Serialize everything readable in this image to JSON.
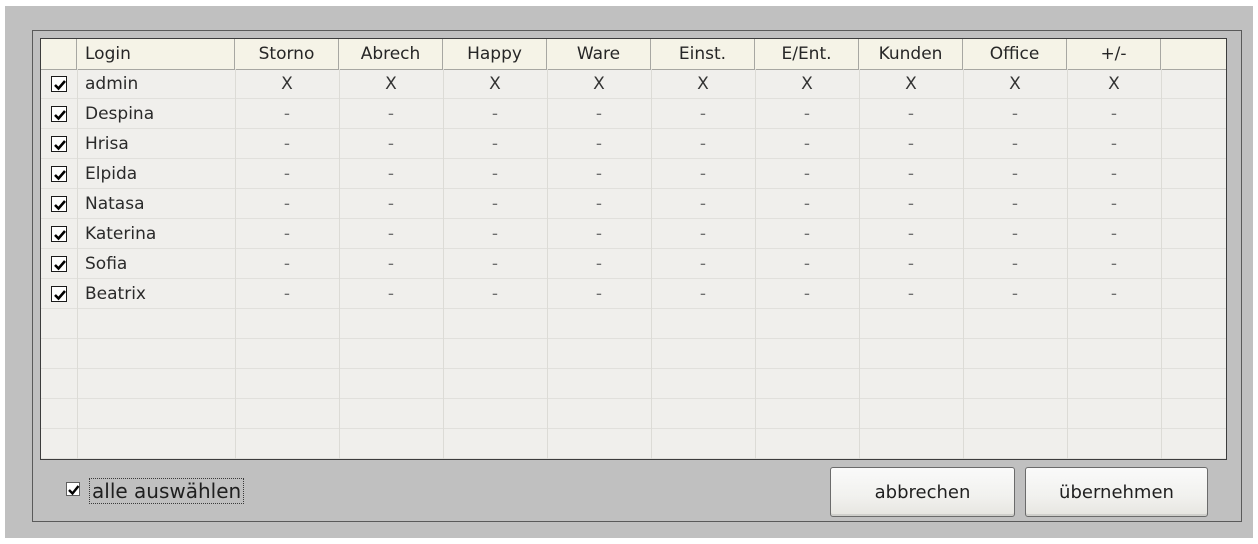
{
  "columns": {
    "login": "Login",
    "storno": "Storno",
    "abrech": "Abrech",
    "happy": "Happy",
    "ware": "Ware",
    "einst": "Einst.",
    "eent": "E/Ent.",
    "kunden": "Kunden",
    "office": "Office",
    "plusminus": "+/-"
  },
  "rows": [
    {
      "checked": true,
      "login": "admin",
      "storno": "X",
      "abrech": "X",
      "happy": "X",
      "ware": "X",
      "einst": "X",
      "eent": "X",
      "kunden": "X",
      "office": "X",
      "plusminus": "X"
    },
    {
      "checked": true,
      "login": "Despina",
      "storno": "-",
      "abrech": "-",
      "happy": "-",
      "ware": "-",
      "einst": "-",
      "eent": "-",
      "kunden": "-",
      "office": "-",
      "plusminus": "-"
    },
    {
      "checked": true,
      "login": "Hrisa",
      "storno": "-",
      "abrech": "-",
      "happy": "-",
      "ware": "-",
      "einst": "-",
      "eent": "-",
      "kunden": "-",
      "office": "-",
      "plusminus": "-"
    },
    {
      "checked": true,
      "login": "Elpida",
      "storno": "-",
      "abrech": "-",
      "happy": "-",
      "ware": "-",
      "einst": "-",
      "eent": "-",
      "kunden": "-",
      "office": "-",
      "plusminus": "-"
    },
    {
      "checked": true,
      "login": "Natasa",
      "storno": "-",
      "abrech": "-",
      "happy": "-",
      "ware": "-",
      "einst": "-",
      "eent": "-",
      "kunden": "-",
      "office": "-",
      "plusminus": "-"
    },
    {
      "checked": true,
      "login": "Katerina",
      "storno": "-",
      "abrech": "-",
      "happy": "-",
      "ware": "-",
      "einst": "-",
      "eent": "-",
      "kunden": "-",
      "office": "-",
      "plusminus": "-"
    },
    {
      "checked": true,
      "login": "Sofia",
      "storno": "-",
      "abrech": "-",
      "happy": "-",
      "ware": "-",
      "einst": "-",
      "eent": "-",
      "kunden": "-",
      "office": "-",
      "plusminus": "-"
    },
    {
      "checked": true,
      "login": "Beatrix",
      "storno": "-",
      "abrech": "-",
      "happy": "-",
      "ware": "-",
      "einst": "-",
      "eent": "-",
      "kunden": "-",
      "office": "-",
      "plusminus": "-"
    }
  ],
  "footer": {
    "select_all_label": "alle auswählen",
    "select_all_checked": true,
    "cancel_label": "abbrechen",
    "apply_label": "übernehmen"
  }
}
